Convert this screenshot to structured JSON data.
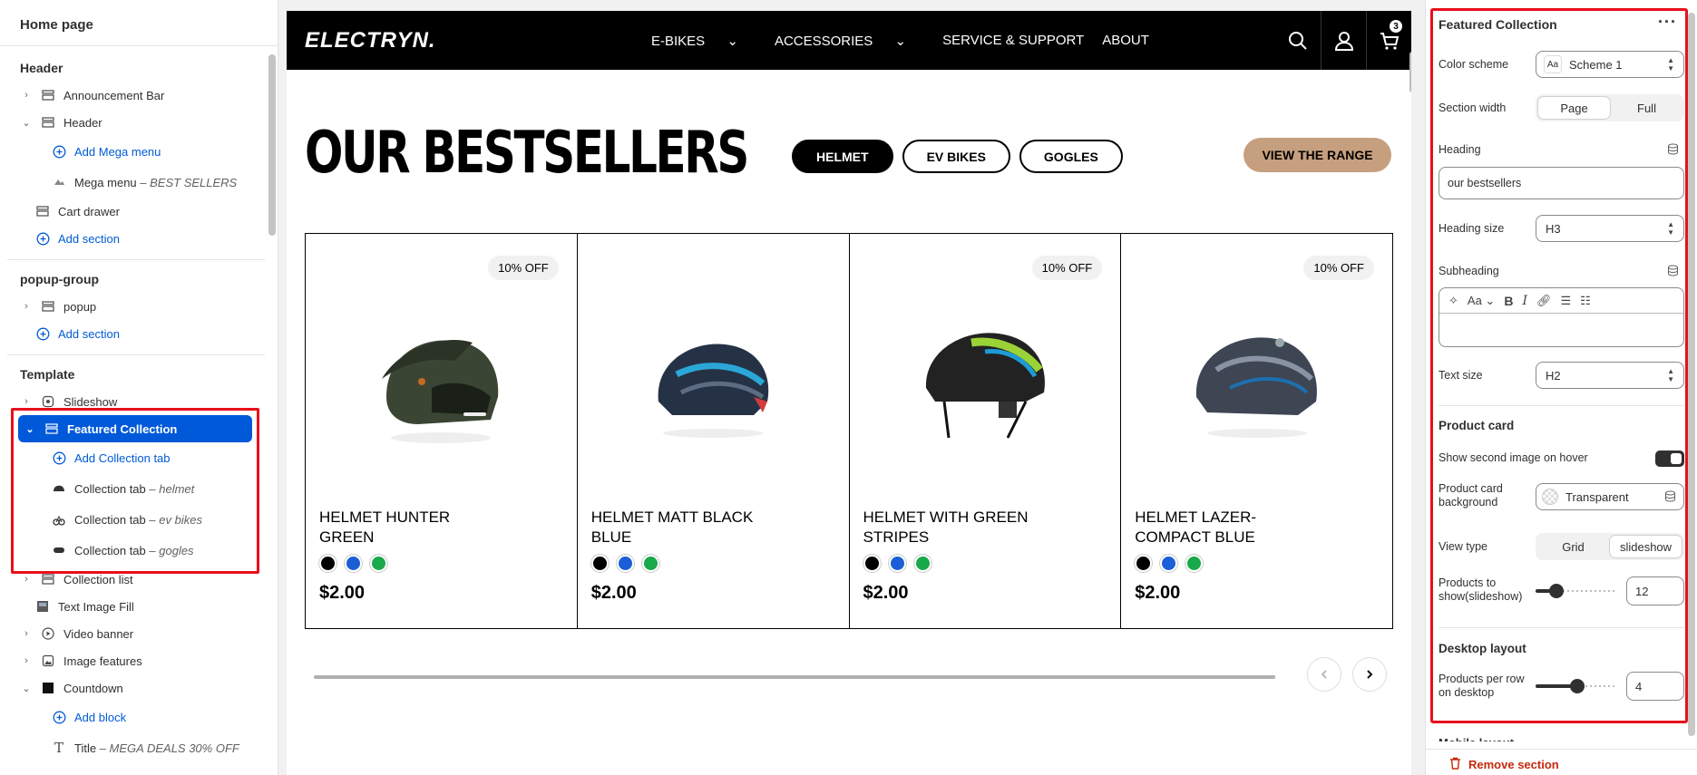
{
  "left_panel": {
    "title": "Home page",
    "header_group": {
      "label": "Header",
      "items": [
        {
          "label": "Announcement Bar"
        },
        {
          "label": "Header"
        },
        {
          "label": "Add Mega menu"
        },
        {
          "label": "Mega menu",
          "sub": "BEST SELLERS"
        },
        {
          "label": "Cart drawer"
        },
        {
          "label": "Add section"
        }
      ]
    },
    "popup_group": {
      "label": "popup-group",
      "items": [
        {
          "label": "popup"
        },
        {
          "label": "Add section"
        }
      ]
    },
    "template_group": {
      "label": "Template",
      "items": [
        {
          "label": "Slideshow"
        },
        {
          "label": "Featured Collection"
        },
        {
          "label": "Add Collection tab"
        },
        {
          "label": "Collection tab",
          "sub": "helmet"
        },
        {
          "label": "Collection tab",
          "sub": "ev bikes"
        },
        {
          "label": "Collection tab",
          "sub": "gogles"
        },
        {
          "label": "Collection list"
        },
        {
          "label": "Text Image Fill"
        },
        {
          "label": "Video banner"
        },
        {
          "label": "Image features"
        },
        {
          "label": "Countdown"
        },
        {
          "label": "Add block"
        },
        {
          "label": "Title",
          "sub": "MEGA DEALS 30% OFF"
        }
      ]
    }
  },
  "store": {
    "logo": "ELECTRYN.",
    "nav": [
      "E-BIKES",
      "ACCESSORIES",
      "SERVICE & SUPPORT",
      "ABOUT"
    ],
    "cart_count": "3",
    "heading": "OUR BESTSELLERS",
    "tabs": [
      "HELMET",
      "EV BIKES",
      "GOGLES"
    ],
    "cta": "VIEW THE RANGE",
    "products": [
      {
        "badge": "10% OFF",
        "name": "HELMET HUNTER GREEN",
        "price": "$2.00"
      },
      {
        "badge": "",
        "name": "HELMET MATT BLACK BLUE",
        "price": "$2.00"
      },
      {
        "badge": "10% OFF",
        "name": "HELMET WITH GREEN STRIPES",
        "price": "$2.00"
      },
      {
        "badge": "10% OFF",
        "name": "HELMET LAZER-COMPACT BLUE",
        "price": "$2.00"
      }
    ],
    "swatch_colors": [
      "#000000",
      "#1a5fd6",
      "#19a84a"
    ],
    "slider_progress": 1.0
  },
  "right_panel": {
    "title": "Featured Collection",
    "color_scheme_label": "Color scheme",
    "color_scheme_value": "Scheme 1",
    "section_width_label": "Section width",
    "section_width_options": [
      "Page",
      "Full"
    ],
    "heading_label": "Heading",
    "heading_value": "our bestsellers",
    "heading_size_label": "Heading size",
    "heading_size_value": "H3",
    "subheading_label": "Subheading",
    "text_size_label": "Text size",
    "text_size_value": "H2",
    "product_card_title": "Product card",
    "second_image_label": "Show second image on hover",
    "second_image_on": true,
    "card_bg_label": "Product card background",
    "card_bg_value": "Transparent",
    "view_type_label": "View type",
    "view_type_options": [
      "Grid",
      "slideshow"
    ],
    "products_show_label": "Products to show(slideshow)",
    "products_show_value": "12",
    "desktop_layout_title": "Desktop layout",
    "per_row_label": "Products per row on desktop",
    "per_row_value": "4",
    "mobile_layout_title": "Mobile layout",
    "remove_label": "Remove section"
  }
}
